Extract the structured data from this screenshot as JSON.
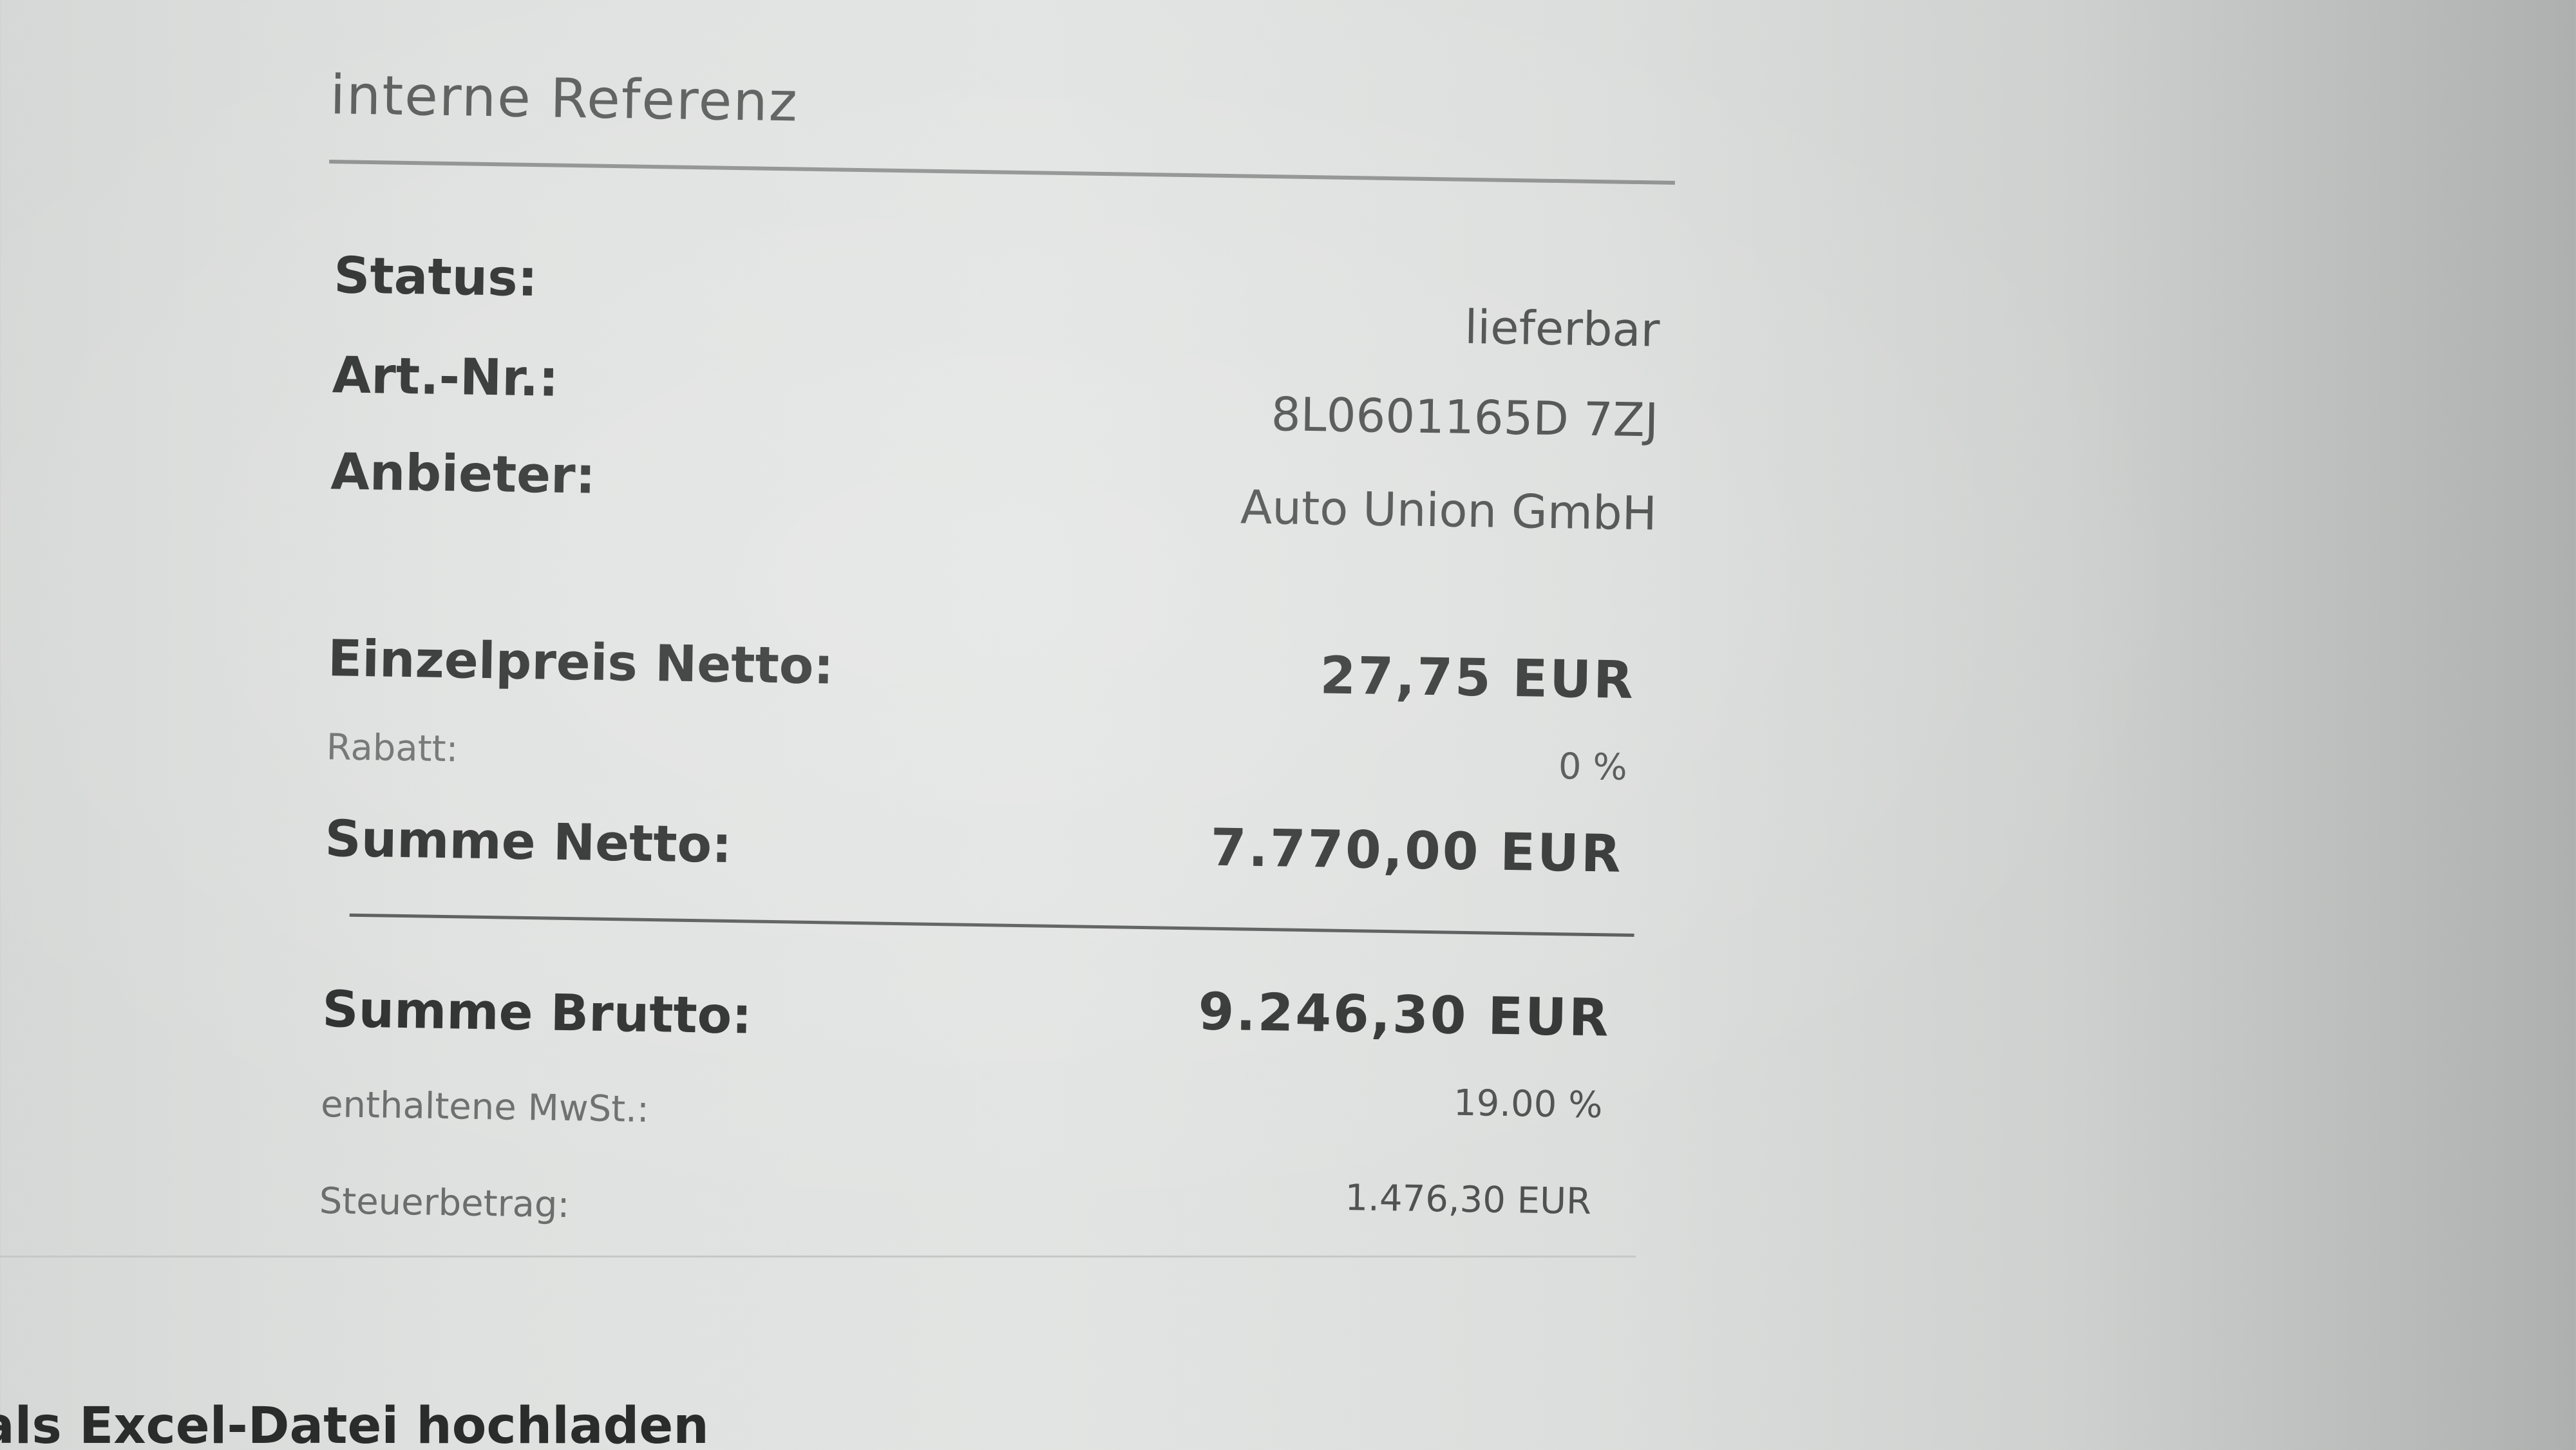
{
  "reference": {
    "placeholder": "interne Referenz"
  },
  "details": {
    "status_label": "Status:",
    "status_value": "lieferbar",
    "article_label": "Art.-Nr.:",
    "article_value": "8L0601165D 7ZJ",
    "supplier_label": "Anbieter:",
    "supplier_value": "Auto Union GmbH"
  },
  "pricing": {
    "unit_net_label": "Einzelpreis Netto:",
    "unit_net_value": "27,75 EUR",
    "discount_label": "Rabatt:",
    "discount_value": "0 %",
    "sum_net_label": "Summe Netto:",
    "sum_net_value": "7.770,00 EUR",
    "sum_gross_label": "Summe Brutto:",
    "sum_gross_value": "9.246,30 EUR",
    "vat_label": "enthaltene MwSt.:",
    "vat_value": "19.00 %",
    "tax_label": "Steuerbetrag:",
    "tax_value": "1.476,30 EUR"
  },
  "actions": {
    "excel_upload_label": "als Excel-Datei hochladen"
  }
}
